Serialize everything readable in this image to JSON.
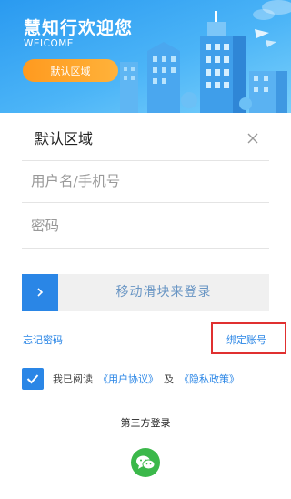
{
  "header": {
    "title": "慧知行欢迎您",
    "welcome": "WEICOME",
    "region_button": "默认区域"
  },
  "form": {
    "region": "默认区域",
    "username_placeholder": "用户名/手机号",
    "password_placeholder": "密码",
    "slider_text": "移动滑块来登录"
  },
  "links": {
    "forgot_password": "忘记密码",
    "bind_account": "绑定账号"
  },
  "agreement": {
    "checked": true,
    "prefix": "我已阅读",
    "user_agreement": "《用户协议》",
    "and": "及",
    "privacy_policy": "《隐私政策》"
  },
  "third_party": {
    "title": "第三方登录",
    "icon": "wechat-icon"
  },
  "colors": {
    "brand_blue": "#2a86e6",
    "header_blue": "#2a9af0",
    "orange": "#ff9a1f",
    "wechat_green": "#3bb84a",
    "highlight_red": "#e03030"
  }
}
